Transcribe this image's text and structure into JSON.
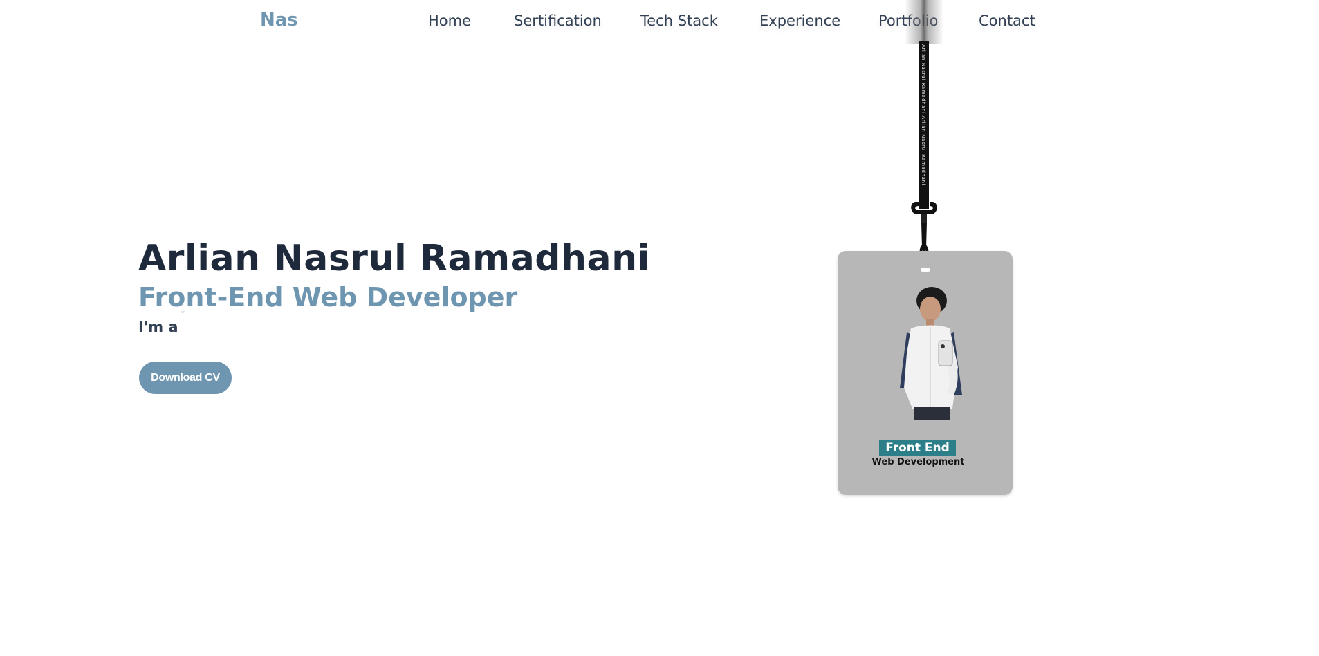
{
  "nav": {
    "logo": "Nas",
    "links": [
      {
        "label": "Home"
      },
      {
        "label": "Sertification"
      },
      {
        "label": "Tech Stack"
      },
      {
        "label": "Experience"
      },
      {
        "label": "Portfolio"
      },
      {
        "label": "Contact"
      }
    ]
  },
  "hero": {
    "name": "Arlian Nasrul Ramadhani",
    "role": "Front-End Web Developer",
    "intro": "I'm a",
    "download_label": "Download CV"
  },
  "badge": {
    "strap_text": "Arlian Nasrul Ramadhani   Arlian Nasrul Ramadhani",
    "tag": "Front End",
    "subtitle": "Web Development"
  },
  "colors": {
    "accent": "#6f96b1",
    "heading": "#1e293b",
    "text": "#334155",
    "badge_bg": "#b7b7b7",
    "badge_tag": "#2c7f88"
  },
  "icons": {
    "lanyard": "lanyard-clip-icon",
    "photo": "portrait-photo"
  }
}
